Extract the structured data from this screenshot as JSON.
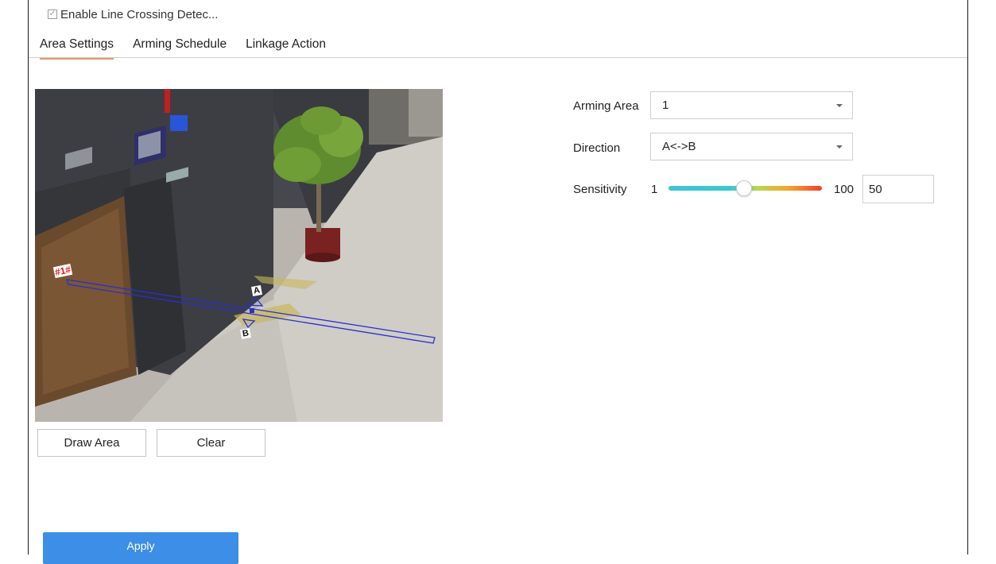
{
  "header": {
    "enable_checkbox_checked": true,
    "enable_label": "Enable Line Crossing Detec..."
  },
  "tabs": [
    {
      "label": "Area Settings",
      "active": true
    },
    {
      "label": "Arming Schedule",
      "active": false
    },
    {
      "label": "Linkage Action",
      "active": false
    }
  ],
  "video": {
    "area_tag": "#1#",
    "point_a": "A",
    "point_b": "B"
  },
  "buttons": {
    "draw_area": "Draw Area",
    "clear": "Clear",
    "apply": "Apply"
  },
  "settings": {
    "arming_area_label": "Arming Area",
    "arming_area_value": "1",
    "direction_label": "Direction",
    "direction_value": "A<->B",
    "sensitivity_label": "Sensitivity",
    "sensitivity_min": "1",
    "sensitivity_max": "100",
    "sensitivity_value": "50"
  },
  "colors": {
    "tab_active_underline": "#e9956a",
    "apply_button": "#3d8ee6",
    "detection_line": "#2a2fd0"
  }
}
